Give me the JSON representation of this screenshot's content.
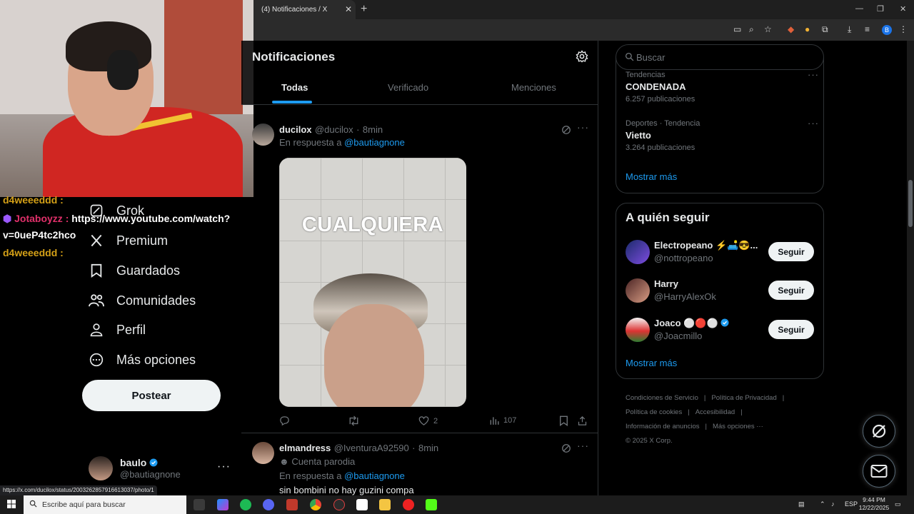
{
  "browser": {
    "tab_title": "(4) Notificaciones / X",
    "status_url": "https://x.com/ducilox/status/2003262857916613037/photo/1",
    "profile_initial": "B"
  },
  "stream_chat": [
    {
      "user": "d4weeeddd :",
      "message": ""
    },
    {
      "user": "Jotaboyzz :",
      "message": "https://www.youtube.com/watch?"
    },
    {
      "user": "",
      "message": "v=0ueP4tc2hco"
    },
    {
      "user": "d4weeeddd :",
      "message": ""
    }
  ],
  "nav": {
    "items": [
      {
        "label": "Grok",
        "icon": "grok-icon"
      },
      {
        "label": "Premium",
        "icon": "x-logo-icon"
      },
      {
        "label": "Guardados",
        "icon": "bookmark-icon"
      },
      {
        "label": "Comunidades",
        "icon": "communities-icon"
      },
      {
        "label": "Perfil",
        "icon": "profile-icon"
      },
      {
        "label": "Más opciones",
        "icon": "more-options-icon"
      }
    ],
    "post_label": "Postear",
    "account": {
      "name": "baulo",
      "handle": "@bautiagnone",
      "verified": true
    }
  },
  "main": {
    "title": "Notificaciones",
    "tabs": [
      "Todas",
      "Verificado",
      "Menciones"
    ],
    "active_tab": "Todas",
    "tweets": [
      {
        "name": "ducilox",
        "handle": "@ducilox",
        "time": "8min",
        "reply_prefix": "En respuesta a",
        "reply_to": "@bautiagnone",
        "image_caption": "CUALQUIERA",
        "actions": {
          "replies": "",
          "reposts": "",
          "likes": "2",
          "views": "107"
        }
      },
      {
        "name": "elmandress",
        "handle": "@IventuraA92590",
        "time": "8min",
        "badge": "Cuenta parodia",
        "reply_prefix": "En respuesta a",
        "reply_to": "@bautiagnone",
        "text": "sin bombini no hay guzini compa"
      }
    ]
  },
  "sidebar": {
    "search_placeholder": "Buscar",
    "trends": [
      {
        "category": "Tendencias",
        "name": "CONDENADA",
        "count": "6.257 publicaciones"
      },
      {
        "category": "Deportes · Tendencia",
        "name": "Vietto",
        "count": "3.264 publicaciones"
      }
    ],
    "trends_show_more": "Mostrar más",
    "follow_title": "A quién seguir",
    "follow": [
      {
        "name": "Electropeano ⚡🛋️😎...",
        "handle": "@nottropeano",
        "button": "Seguir"
      },
      {
        "name": "Harry",
        "handle": "@HarryAlexOk",
        "button": "Seguir"
      },
      {
        "name": "Joaco ⚪🔴⚪",
        "handle": "@Joacmillo",
        "button": "Seguir",
        "verified": true
      }
    ],
    "follow_show_more": "Mostrar más",
    "footer": [
      "Condiciones de Servicio",
      "|",
      "Política de Privacidad",
      "|",
      "Política de cookies",
      "|",
      "Accesibilidad",
      "|",
      "Información de anuncios",
      "|",
      "Más opciones ···",
      "© 2025 X Corp."
    ]
  },
  "taskbar": {
    "search_placeholder": "Escribe aquí para buscar",
    "language": "ESP",
    "time": "9:44 PM",
    "date": "12/22/2025"
  },
  "colors": {
    "accent": "#1d9bf0",
    "background": "#000000",
    "border": "#2f3336",
    "muted": "#71767b"
  }
}
